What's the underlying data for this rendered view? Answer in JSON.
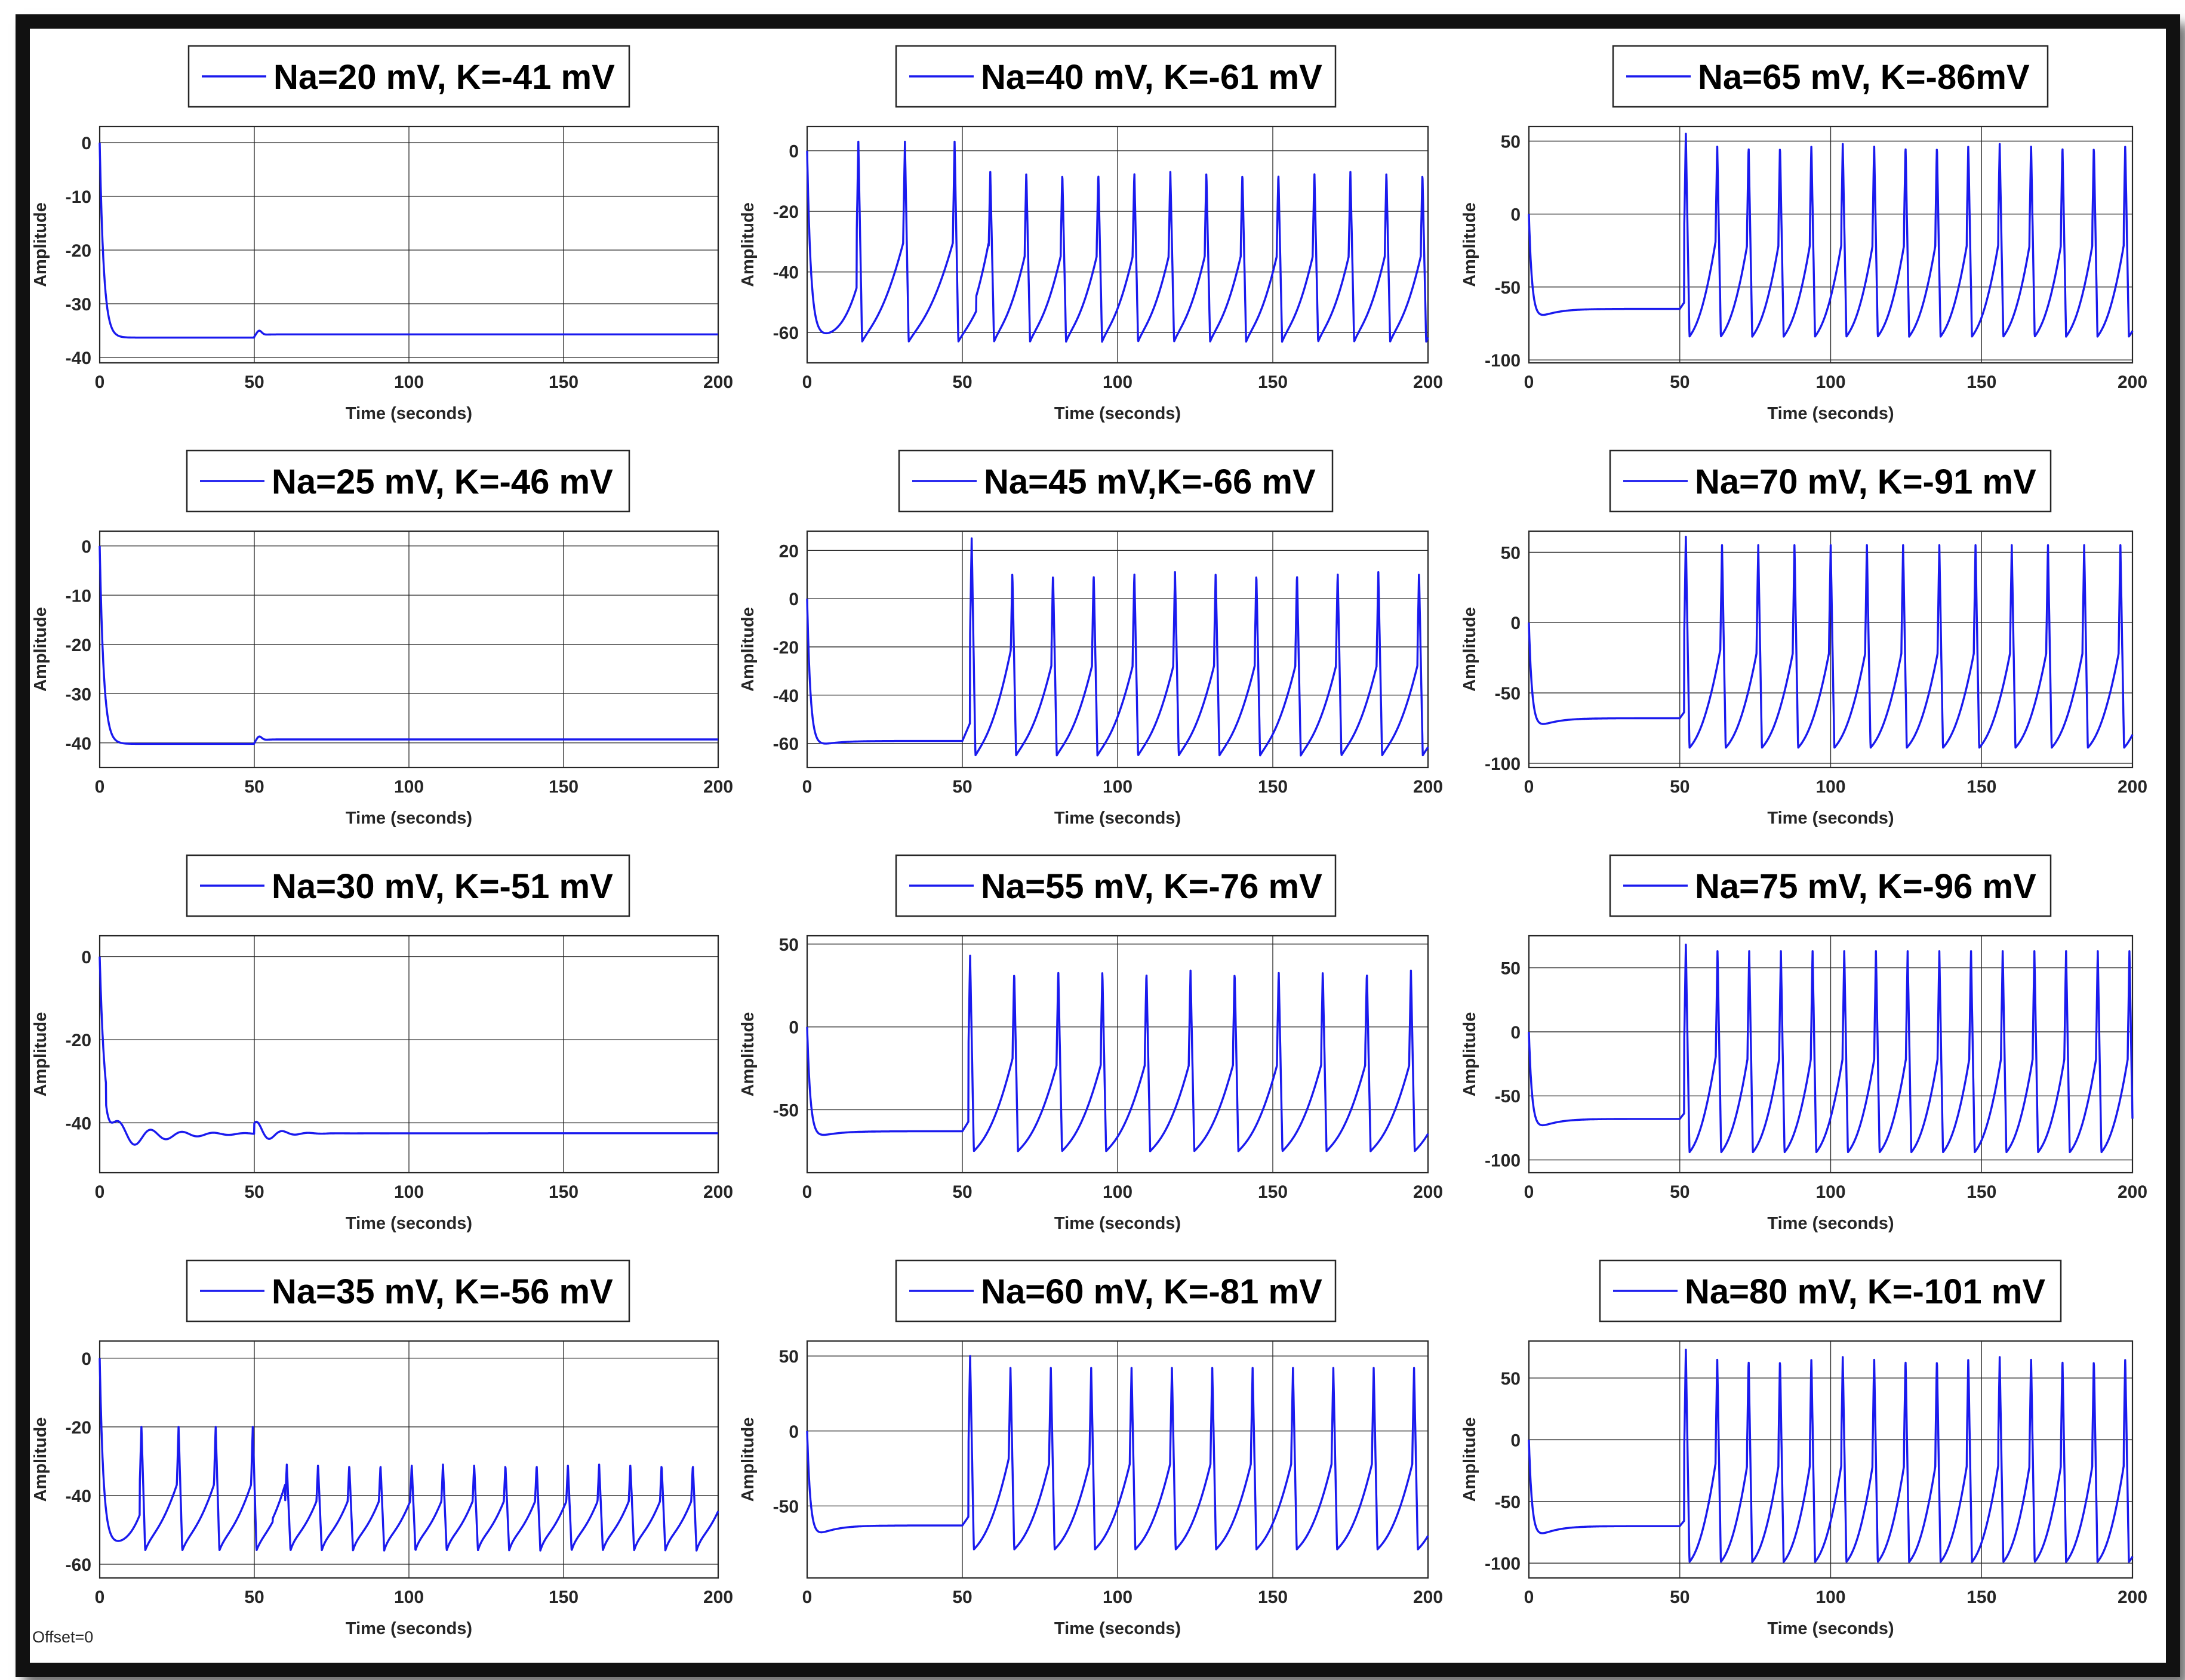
{
  "x_axis_label": "Time (seconds)",
  "y_axis_label": "Amplitude",
  "offset_label": "Offset=0",
  "colors": {
    "trace": "#1a1aee",
    "grid": "#262626",
    "frame": "#111111"
  },
  "chart_data": [
    {
      "type": "line",
      "series": [
        {
          "name": "Na=20 mV, K=-41 mV"
        }
      ],
      "xlabel": "Time (seconds)",
      "ylabel": "Amplitude",
      "xlim": [
        0,
        200
      ],
      "ylim": [
        -41,
        3
      ],
      "xticks": [
        0,
        50,
        100,
        150,
        200
      ],
      "yticks": [
        0,
        -10,
        -20,
        -30,
        -40
      ],
      "grid": true,
      "legend": "top-center",
      "waveform": {
        "pattern": "rest",
        "resting": -36.3,
        "after_stim": -35.7
      }
    },
    {
      "type": "line",
      "series": [
        {
          "name": "Na=40 mV, K=-61 mV"
        }
      ],
      "xlabel": "Time (seconds)",
      "ylabel": "Amplitude",
      "xlim": [
        0,
        200
      ],
      "ylim": [
        -70,
        8
      ],
      "xticks": [
        0,
        50,
        100,
        150,
        200
      ],
      "yticks": [
        0,
        -20,
        -40,
        -60
      ],
      "grid": true,
      "legend": "top-center",
      "waveform": {
        "pattern": "spiking",
        "early_spike_times": [
          16,
          31,
          47
        ],
        "early_peak": 3,
        "spike_start": 58.5,
        "spike_period": 11.6,
        "peak": -7,
        "trough": -61
      }
    },
    {
      "type": "line",
      "series": [
        {
          "name": "Na=65 mV, K=-86mV"
        }
      ],
      "xlabel": "Time (seconds)",
      "ylabel": "Amplitude",
      "xlim": [
        0,
        200
      ],
      "ylim": [
        -102,
        60
      ],
      "xticks": [
        0,
        50,
        100,
        150,
        200
      ],
      "yticks": [
        50,
        0,
        -50,
        -100
      ],
      "grid": true,
      "legend": "top-center",
      "waveform": {
        "pattern": "stim_spiking",
        "initial_dip": -77,
        "plateau": -65,
        "spike_start": 51.5,
        "spike_period": 10.4,
        "peak": 48,
        "first_peak": 55,
        "trough": -82
      }
    },
    {
      "type": "line",
      "series": [
        {
          "name": "Na=25 mV, K=-46 mV"
        }
      ],
      "xlabel": "Time (seconds)",
      "ylabel": "Amplitude",
      "xlim": [
        0,
        200
      ],
      "ylim": [
        -45,
        3
      ],
      "xticks": [
        0,
        50,
        100,
        150,
        200
      ],
      "yticks": [
        0,
        -10,
        -20,
        -30,
        -40
      ],
      "grid": true,
      "legend": "top-center",
      "waveform": {
        "pattern": "rest",
        "resting": -40.2,
        "after_stim": -39.3
      }
    },
    {
      "type": "line",
      "series": [
        {
          "name": "Na=45 mV,K=-66 mV"
        }
      ],
      "xlabel": "Time (seconds)",
      "ylabel": "Amplitude",
      "xlim": [
        0,
        200
      ],
      "ylim": [
        -70,
        28
      ],
      "xticks": [
        0,
        50,
        100,
        150,
        200
      ],
      "yticks": [
        20,
        0,
        -20,
        -40,
        -60
      ],
      "grid": true,
      "legend": "top-center",
      "waveform": {
        "pattern": "stim_spiking",
        "initial_dip": -63,
        "plateau": -59,
        "spike_start": 52.5,
        "spike_period": 13.1,
        "peak": 11,
        "first_peak": 25,
        "trough": -63
      }
    },
    {
      "type": "line",
      "series": [
        {
          "name": "Na=70 mV, K=-91 mV"
        }
      ],
      "xlabel": "Time (seconds)",
      "ylabel": "Amplitude",
      "xlim": [
        0,
        200
      ],
      "ylim": [
        -103,
        65
      ],
      "xticks": [
        0,
        50,
        100,
        150,
        200
      ],
      "yticks": [
        50,
        0,
        -50,
        -100
      ],
      "grid": true,
      "legend": "top-center",
      "waveform": {
        "pattern": "stim_spiking",
        "initial_dip": -80,
        "plateau": -68,
        "spike_start": 51.5,
        "spike_period": 12.0,
        "peak": 55,
        "first_peak": 61,
        "trough": -87
      }
    },
    {
      "type": "line",
      "series": [
        {
          "name": "Na=30 mV, K=-51 mV"
        }
      ],
      "xlabel": "Time (seconds)",
      "ylabel": "Amplitude",
      "xlim": [
        0,
        200
      ],
      "ylim": [
        -52,
        5
      ],
      "xticks": [
        0,
        50,
        100,
        150,
        200
      ],
      "yticks": [
        0,
        -20,
        -40
      ],
      "grid": true,
      "legend": "top-center",
      "waveform": {
        "pattern": "damped",
        "resting": -42.5,
        "dip": -46
      }
    },
    {
      "type": "line",
      "series": [
        {
          "name": "Na=55 mV, K=-76 mV"
        }
      ],
      "xlabel": "Time (seconds)",
      "ylabel": "Amplitude",
      "xlim": [
        0,
        200
      ],
      "ylim": [
        -88,
        55
      ],
      "xticks": [
        0,
        50,
        100,
        150,
        200
      ],
      "yticks": [
        50,
        0,
        -50
      ],
      "grid": true,
      "legend": "top-center",
      "waveform": {
        "pattern": "stim_spiking",
        "initial_dip": -70,
        "plateau": -63,
        "spike_start": 52,
        "spike_period": 14.2,
        "peak": 34,
        "first_peak": 43,
        "trough": -73
      }
    },
    {
      "type": "line",
      "series": [
        {
          "name": "Na=75 mV, K=-96 mV"
        }
      ],
      "xlabel": "Time (seconds)",
      "ylabel": "Amplitude",
      "xlim": [
        0,
        200
      ],
      "ylim": [
        -110,
        75
      ],
      "xticks": [
        0,
        50,
        100,
        150,
        200
      ],
      "yticks": [
        50,
        0,
        -50,
        -100
      ],
      "grid": true,
      "legend": "top-center",
      "waveform": {
        "pattern": "stim_spiking",
        "initial_dip": -82,
        "plateau": -68,
        "spike_start": 51.5,
        "spike_period": 10.5,
        "peak": 63,
        "first_peak": 68,
        "trough": -92
      }
    },
    {
      "type": "line",
      "series": [
        {
          "name": "Na=35 mV, K=-56 mV"
        }
      ],
      "xlabel": "Time (seconds)",
      "ylabel": "Amplitude",
      "xlim": [
        0,
        200
      ],
      "ylim": [
        -64,
        5
      ],
      "xticks": [
        0,
        50,
        100,
        150,
        200
      ],
      "yticks": [
        0,
        -20,
        -40,
        -60
      ],
      "grid": true,
      "legend": "top-center",
      "waveform": {
        "pattern": "spiking",
        "early_spike_times": [
          13,
          25,
          37,
          49
        ],
        "early_peak": -20,
        "spike_start": 60,
        "spike_period": 10.1,
        "peak": -31,
        "trough": -54
      }
    },
    {
      "type": "line",
      "series": [
        {
          "name": "Na=60 mV, K=-81 mV"
        }
      ],
      "xlabel": "Time (seconds)",
      "ylabel": "Amplitude",
      "xlim": [
        0,
        200
      ],
      "ylim": [
        -98,
        60
      ],
      "xticks": [
        0,
        50,
        100,
        150,
        200
      ],
      "yticks": [
        50,
        0,
        -50
      ],
      "grid": true,
      "legend": "top-center",
      "waveform": {
        "pattern": "stim_spiking",
        "initial_dip": -76,
        "plateau": -63,
        "spike_start": 52,
        "spike_period": 13.0,
        "peak": 42,
        "first_peak": 50,
        "trough": -77
      }
    },
    {
      "type": "line",
      "series": [
        {
          "name": "Na=80 mV, K=-101 mV"
        }
      ],
      "xlabel": "Time (seconds)",
      "ylabel": "Amplitude",
      "xlim": [
        0,
        200
      ],
      "ylim": [
        -112,
        80
      ],
      "xticks": [
        0,
        50,
        100,
        150,
        200
      ],
      "yticks": [
        50,
        0,
        -50,
        -100
      ],
      "grid": true,
      "legend": "top-center",
      "waveform": {
        "pattern": "stim_spiking",
        "initial_dip": -86,
        "plateau": -70,
        "spike_start": 51.5,
        "spike_period": 10.4,
        "peak": 67,
        "first_peak": 73,
        "trough": -97
      }
    }
  ]
}
